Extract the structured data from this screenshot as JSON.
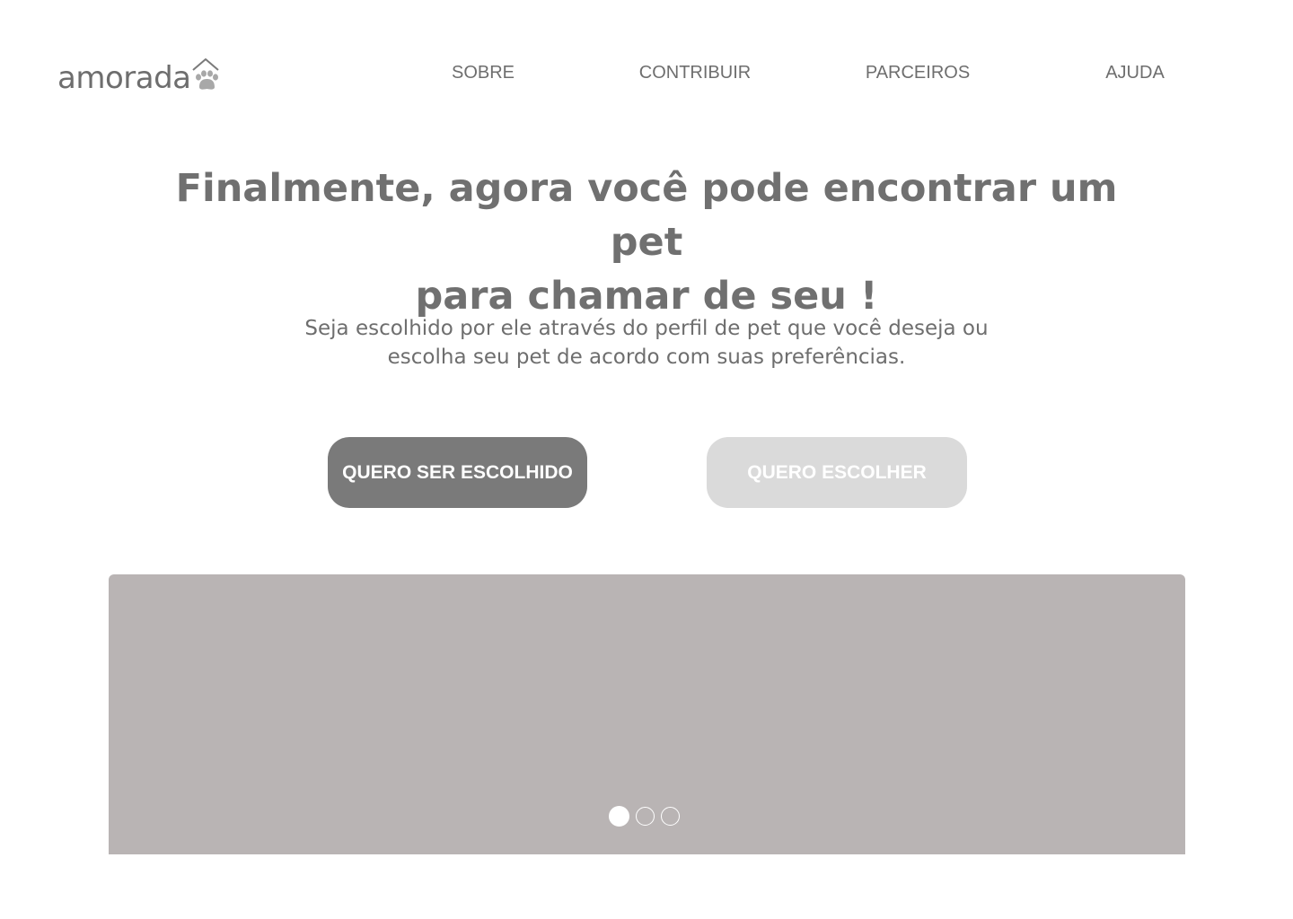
{
  "header": {
    "logo_text": "amorada",
    "logo_icon": "house-paw-icon",
    "nav": [
      {
        "label": "SOBRE"
      },
      {
        "label": "CONTRIBUIR"
      },
      {
        "label": "PARCEIROS"
      },
      {
        "label": "AJUDA"
      }
    ]
  },
  "hero": {
    "headline_line1": "Finalmente, agora você pode encontrar um pet",
    "headline_line2": "para chamar de seu !",
    "subtext_line1": "Seja escolhido por ele através do perfil de pet que você deseja ou",
    "subtext_line2": "escolha seu pet de acordo com suas preferências.",
    "primary_button": "QUERO SER ESCOLHIDO",
    "secondary_button": "QUERO ESCOLHER"
  },
  "carousel": {
    "slide_count": 3,
    "active_slide": 1
  },
  "colors": {
    "text": "#6e6e6e",
    "primary_button": "#7a7a7a",
    "secondary_button": "#dadada",
    "carousel_bg": "#b9b4b4",
    "logo_paw": "#a8a8a8"
  }
}
